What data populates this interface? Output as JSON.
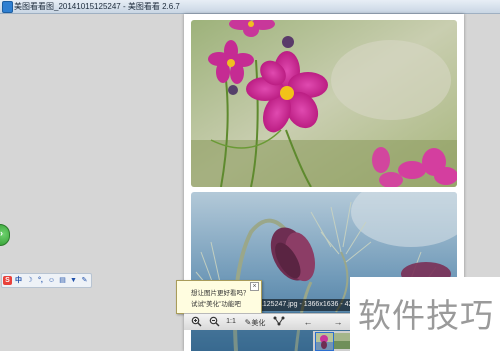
{
  "window": {
    "title": "美图看看图_20141015125247 - 美图看看 2.6.7",
    "icon": "meitu-kankan-app-icon"
  },
  "sidebar": {
    "expand_handle_label": "›"
  },
  "ime_toolbar": {
    "items": [
      "S",
      "中",
      "☽",
      "°,",
      "☺",
      "▤",
      "▼",
      "✎"
    ]
  },
  "tooltip": {
    "line1": "想让图片更好看吗？",
    "line2": "试试“美化”功能吧",
    "close_label": "×"
  },
  "info_bar": {
    "filename_info": "..125247.jpg - 1366x1636 - 42%"
  },
  "toolbar": {
    "zoom_in_icon": "zoom-in-icon",
    "zoom_out_icon": "zoom-out-icon",
    "actual_size_label": "1:1",
    "beautify_label": "美化",
    "prev_label": "←",
    "next_label": "→"
  },
  "watermark": {
    "text": "软件技巧"
  },
  "colors": {
    "workspace": "#d6d6d6",
    "title_bar": "#c9d6e4",
    "tooltip_bg": "#fffde0",
    "accent_blue": "#2b6fd0"
  }
}
